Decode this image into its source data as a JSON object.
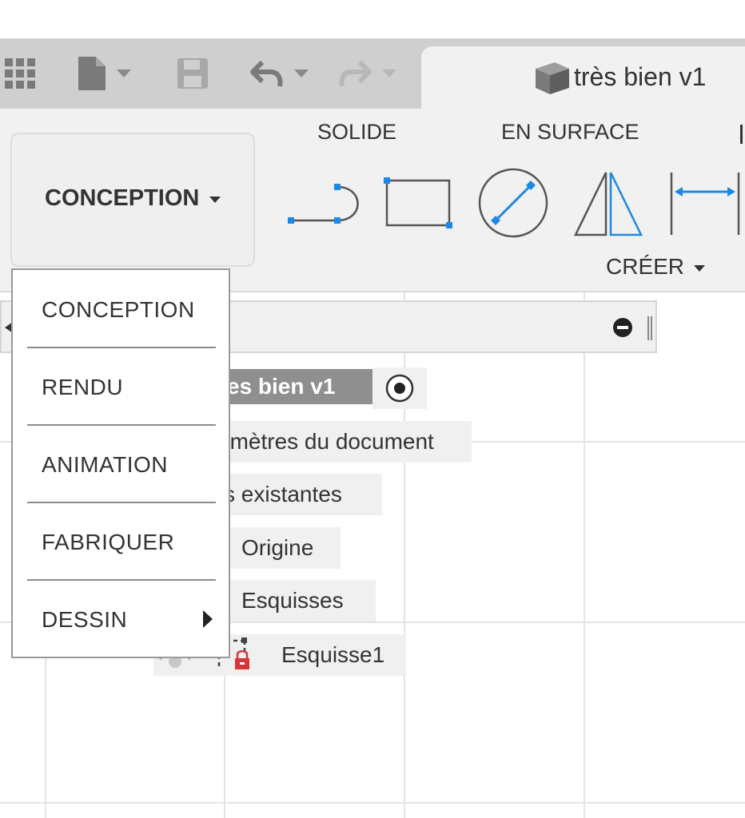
{
  "toolbar": {
    "document_title": "très bien v1"
  },
  "ribbon": {
    "workspace_label": "CONCEPTION",
    "tabs": [
      "SOLIDE",
      "EN SURFACE"
    ],
    "create_label": "CRÉER"
  },
  "browser": {
    "root_label": "es bien v1",
    "items": [
      {
        "label": "amètres du document"
      },
      {
        "label": "s existantes"
      },
      {
        "label": "Origine"
      },
      {
        "label": "Esquisses"
      },
      {
        "label": "Esquisse1"
      }
    ]
  },
  "workspace_menu": {
    "items": [
      {
        "label": "CONCEPTION"
      },
      {
        "label": "RENDU"
      },
      {
        "label": "ANIMATION"
      },
      {
        "label": "FABRIQUER"
      },
      {
        "label": "DESSIN"
      }
    ]
  },
  "colors": {
    "accent_blue": "#1e88e5",
    "sketch_lock_red": "#d9343a",
    "toolbar_gray": "#cfcfcf",
    "ribbon_bg": "#f1f1f1"
  }
}
